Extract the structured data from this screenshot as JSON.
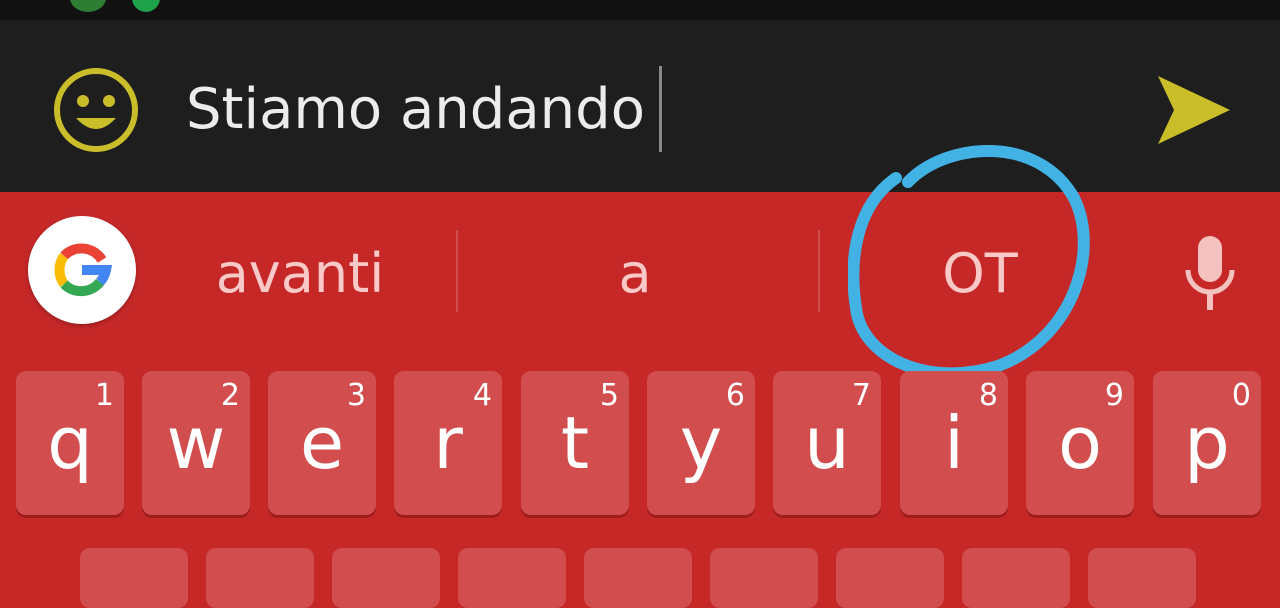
{
  "compose": {
    "message_text": "Stiamo andando",
    "emoji_icon": "smiley-face-icon",
    "send_icon": "send-arrow-icon"
  },
  "suggestions": {
    "google_icon": "google-g-icon",
    "items": [
      "avanti",
      "a",
      "OT"
    ],
    "mic_icon": "microphone-icon"
  },
  "keyboard": {
    "row1": [
      {
        "letter": "q",
        "number": "1"
      },
      {
        "letter": "w",
        "number": "2"
      },
      {
        "letter": "e",
        "number": "3"
      },
      {
        "letter": "r",
        "number": "4"
      },
      {
        "letter": "t",
        "number": "5"
      },
      {
        "letter": "y",
        "number": "6"
      },
      {
        "letter": "u",
        "number": "7"
      },
      {
        "letter": "i",
        "number": "8"
      },
      {
        "letter": "o",
        "number": "9"
      },
      {
        "letter": "p",
        "number": "0"
      }
    ]
  },
  "colors": {
    "keyboard_bg": "#c62828",
    "key_bg": "#d24d4d",
    "compose_bg": "#1e1e1e",
    "accent": "#c9bd2a",
    "annotation": "#42b2e4"
  }
}
